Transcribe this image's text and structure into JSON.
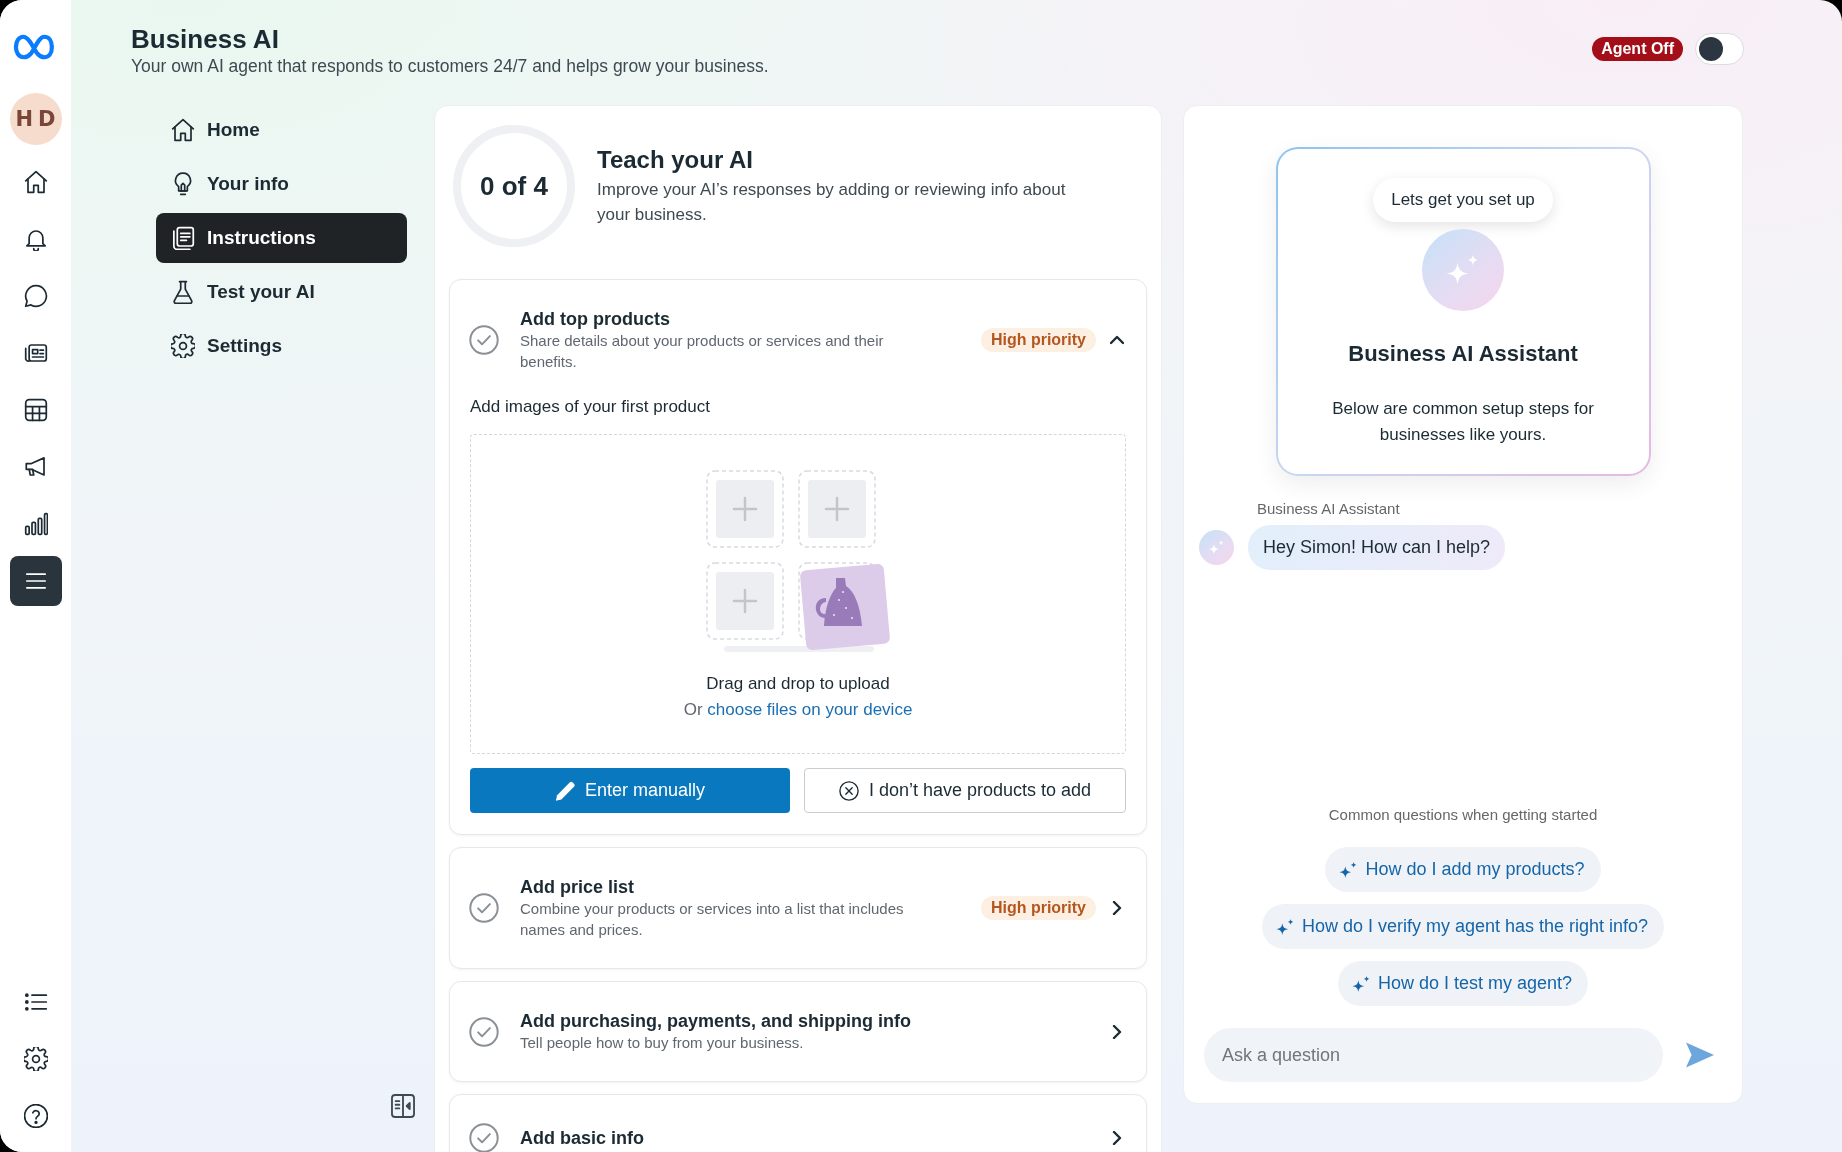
{
  "rail": {
    "avatar": "HD",
    "items": [
      {
        "selected": false
      },
      {
        "selected": false
      },
      {
        "selected": false
      },
      {
        "selected": false
      },
      {
        "selected": false
      },
      {
        "selected": false
      },
      {
        "selected": false
      },
      {
        "selected": true
      }
    ]
  },
  "header": {
    "title": "Business AI",
    "subtitle": "Your own AI agent that responds to customers 24/7 and helps grow your business.",
    "agent_status": "Agent Off",
    "agent_on": false
  },
  "nav": {
    "items": [
      {
        "label": "Home",
        "selected": false
      },
      {
        "label": "Your info",
        "selected": false
      },
      {
        "label": "Instructions",
        "selected": true
      },
      {
        "label": "Test your AI",
        "selected": false
      },
      {
        "label": "Settings",
        "selected": false
      }
    ]
  },
  "teach": {
    "progress": "0 of 4",
    "title": "Teach your AI",
    "description": "Improve your AI’s responses by adding or reviewing info about your business."
  },
  "tasks": [
    {
      "title": "Add top products",
      "description": "Share details about your products or services and their benefits.",
      "priority": "High priority",
      "done": false,
      "expanded": true,
      "upload": {
        "label": "Add images of your first product",
        "drop_text": "Drag and drop to upload",
        "or_text": "Or",
        "link": "choose files on your device",
        "buttons": [
          {
            "label": "Enter manually",
            "kind": "primary"
          },
          {
            "label": "I don’t have products to add",
            "kind": "secondary"
          }
        ]
      }
    },
    {
      "title": "Add price list",
      "description": "Combine your products or services into a list that includes names and prices.",
      "priority": "High priority",
      "done": false,
      "expanded": false
    },
    {
      "title": "Add purchasing, payments, and shipping info",
      "description": "Tell people how to buy from your business.",
      "done": false,
      "expanded": false
    },
    {
      "title": "Add basic info",
      "done": false,
      "expanded": false
    }
  ],
  "assistant": {
    "bubble": "Lets get you set up",
    "name": "Business AI Assistant",
    "intro": "Below are common setup steps for businesses like yours.",
    "messages": [
      {
        "sender": "Business AI Assistant",
        "text": "Hey Simon! How can I help?"
      }
    ],
    "suggestions_title": "Common questions when getting started",
    "suggestions": [
      "How do I add my products?",
      "How do I verify my agent has the right info?",
      "How do I test my agent?"
    ],
    "input": {
      "placeholder": "Ask a question"
    }
  }
}
